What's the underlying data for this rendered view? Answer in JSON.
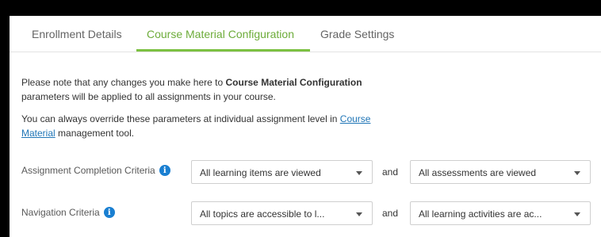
{
  "tabs": [
    {
      "label": "Enrollment Details"
    },
    {
      "label": "Course Material Configuration",
      "active": true
    },
    {
      "label": "Grade Settings"
    }
  ],
  "notice": {
    "p1_before": "Please note that any changes you make here to ",
    "p1_bold": "Course Material Configuration",
    "p1_after": " parameters will be applied to all assignments in your course.",
    "p2_before": "You can always override these parameters at individual assignment level in ",
    "p2_link": "Course Material",
    "p2_after": " management tool."
  },
  "rows": [
    {
      "label": "Assignment Completion Criteria",
      "select1": "All learning items are viewed",
      "conj": "and",
      "select2": "All assessments are viewed"
    },
    {
      "label": "Navigation Criteria",
      "select1": "All topics are accessible to l...",
      "conj": "and",
      "select2": "All learning activities are ac..."
    }
  ],
  "colors": {
    "active_tab": "#6dac3a",
    "underline": "#7cc141",
    "info_icon": "#1a7fd1",
    "link": "#1f75b6"
  }
}
